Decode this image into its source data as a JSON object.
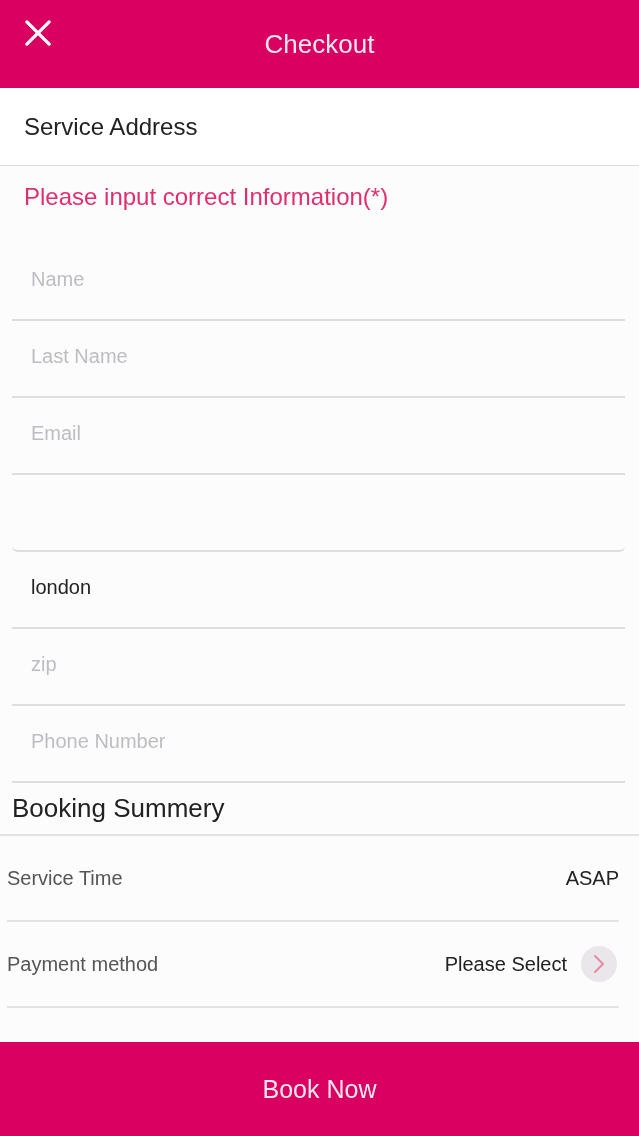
{
  "header": {
    "title": "Checkout"
  },
  "section": {
    "title": "Service Address"
  },
  "notice": "Please input correct Information(*)",
  "fields": [
    {
      "kind": "text",
      "placeholder": "Name"
    },
    {
      "kind": "text",
      "placeholder": "Last Name"
    },
    {
      "kind": "text",
      "placeholder": "Email"
    },
    {
      "kind": "multiline"
    },
    {
      "kind": "text",
      "value": "london"
    },
    {
      "kind": "text",
      "placeholder": "zip"
    },
    {
      "kind": "text",
      "placeholder": "Phone Number"
    }
  ],
  "summary": {
    "title": "Booking Summery",
    "rows": [
      {
        "kind": "static",
        "label": "Service Time",
        "value": "ASAP"
      },
      {
        "kind": "select",
        "label": "Payment method",
        "value": "Please Select"
      }
    ]
  },
  "book_button": {
    "label": "Book Now"
  }
}
